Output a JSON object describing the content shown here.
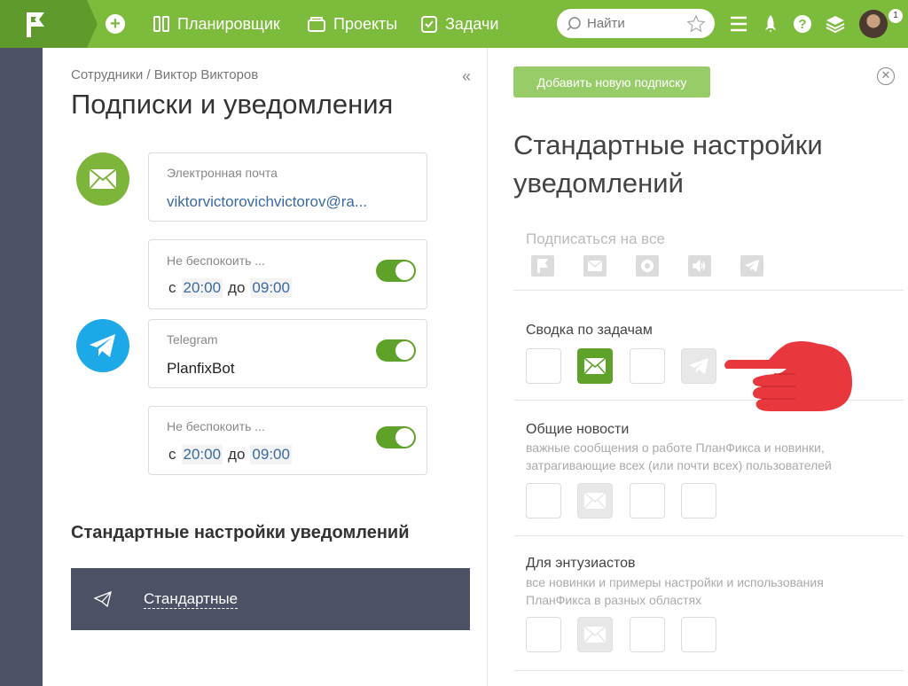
{
  "topbar": {
    "nav": [
      {
        "label": "Планировщик",
        "icon": "planner-icon"
      },
      {
        "label": "Проекты",
        "icon": "projects-icon"
      },
      {
        "label": "Задачи",
        "icon": "tasks-icon"
      }
    ],
    "search_placeholder": "Найти",
    "badge_count": "1",
    "brand_color": "#7dbb3c"
  },
  "left": {
    "breadcrumb": "Сотрудники / Виктор Викторов",
    "title": "Подписки и уведомления",
    "email_card": {
      "label": "Электронная почта",
      "value": "viktorvictorovichvictorov@ra..."
    },
    "dnd_email": {
      "label": "Не беспокоить ...",
      "from_label": "с",
      "from": "20:00",
      "to_label": "до",
      "to": "09:00",
      "enabled": true
    },
    "telegram_card": {
      "label": "Telegram",
      "value": "PlanfixBot"
    },
    "dnd_tg": {
      "label": "Не беспокоить ...",
      "from_label": "с",
      "from": "20:00",
      "to_label": "до",
      "to": "09:00",
      "enabled": true
    },
    "section_title": "Стандартные настройки уведомлений",
    "std_item": "Стандартные"
  },
  "right": {
    "add_button": "Добавить новую подписку",
    "title": "Стандартные настройки уведомлений",
    "subscribe_all": "Подписаться на все",
    "groups": [
      {
        "title": "Сводка по задачам",
        "desc": "",
        "states": [
          "off",
          "on",
          "off",
          "disabled"
        ]
      },
      {
        "title": "Общие новости",
        "desc": "важные сообщения о работе ПланФикса и новинки, затрагивающие всех (или почти всех) пользователей",
        "states": [
          "off",
          "disabled",
          "off",
          "off"
        ]
      },
      {
        "title": "Для энтузиастов",
        "desc": "все новинки и примеры настройки и использования ПланФикса в разных областях",
        "states": [
          "off",
          "disabled",
          "off",
          "off"
        ]
      }
    ]
  }
}
